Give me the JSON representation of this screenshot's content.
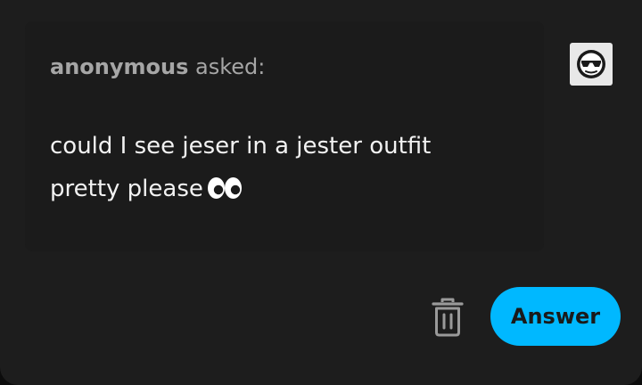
{
  "ask": {
    "asker_name": "anonymous",
    "asker_suffix": " asked:",
    "question_line1": "could I see jeser in a jester outfit",
    "question_line2": "pretty please",
    "emoji": "eyes-icon"
  },
  "avatar": {
    "icon": "sunglasses-face-icon"
  },
  "actions": {
    "delete_icon": "trash-icon",
    "answer_label": "Answer",
    "answer_color": "#00b8ff"
  }
}
